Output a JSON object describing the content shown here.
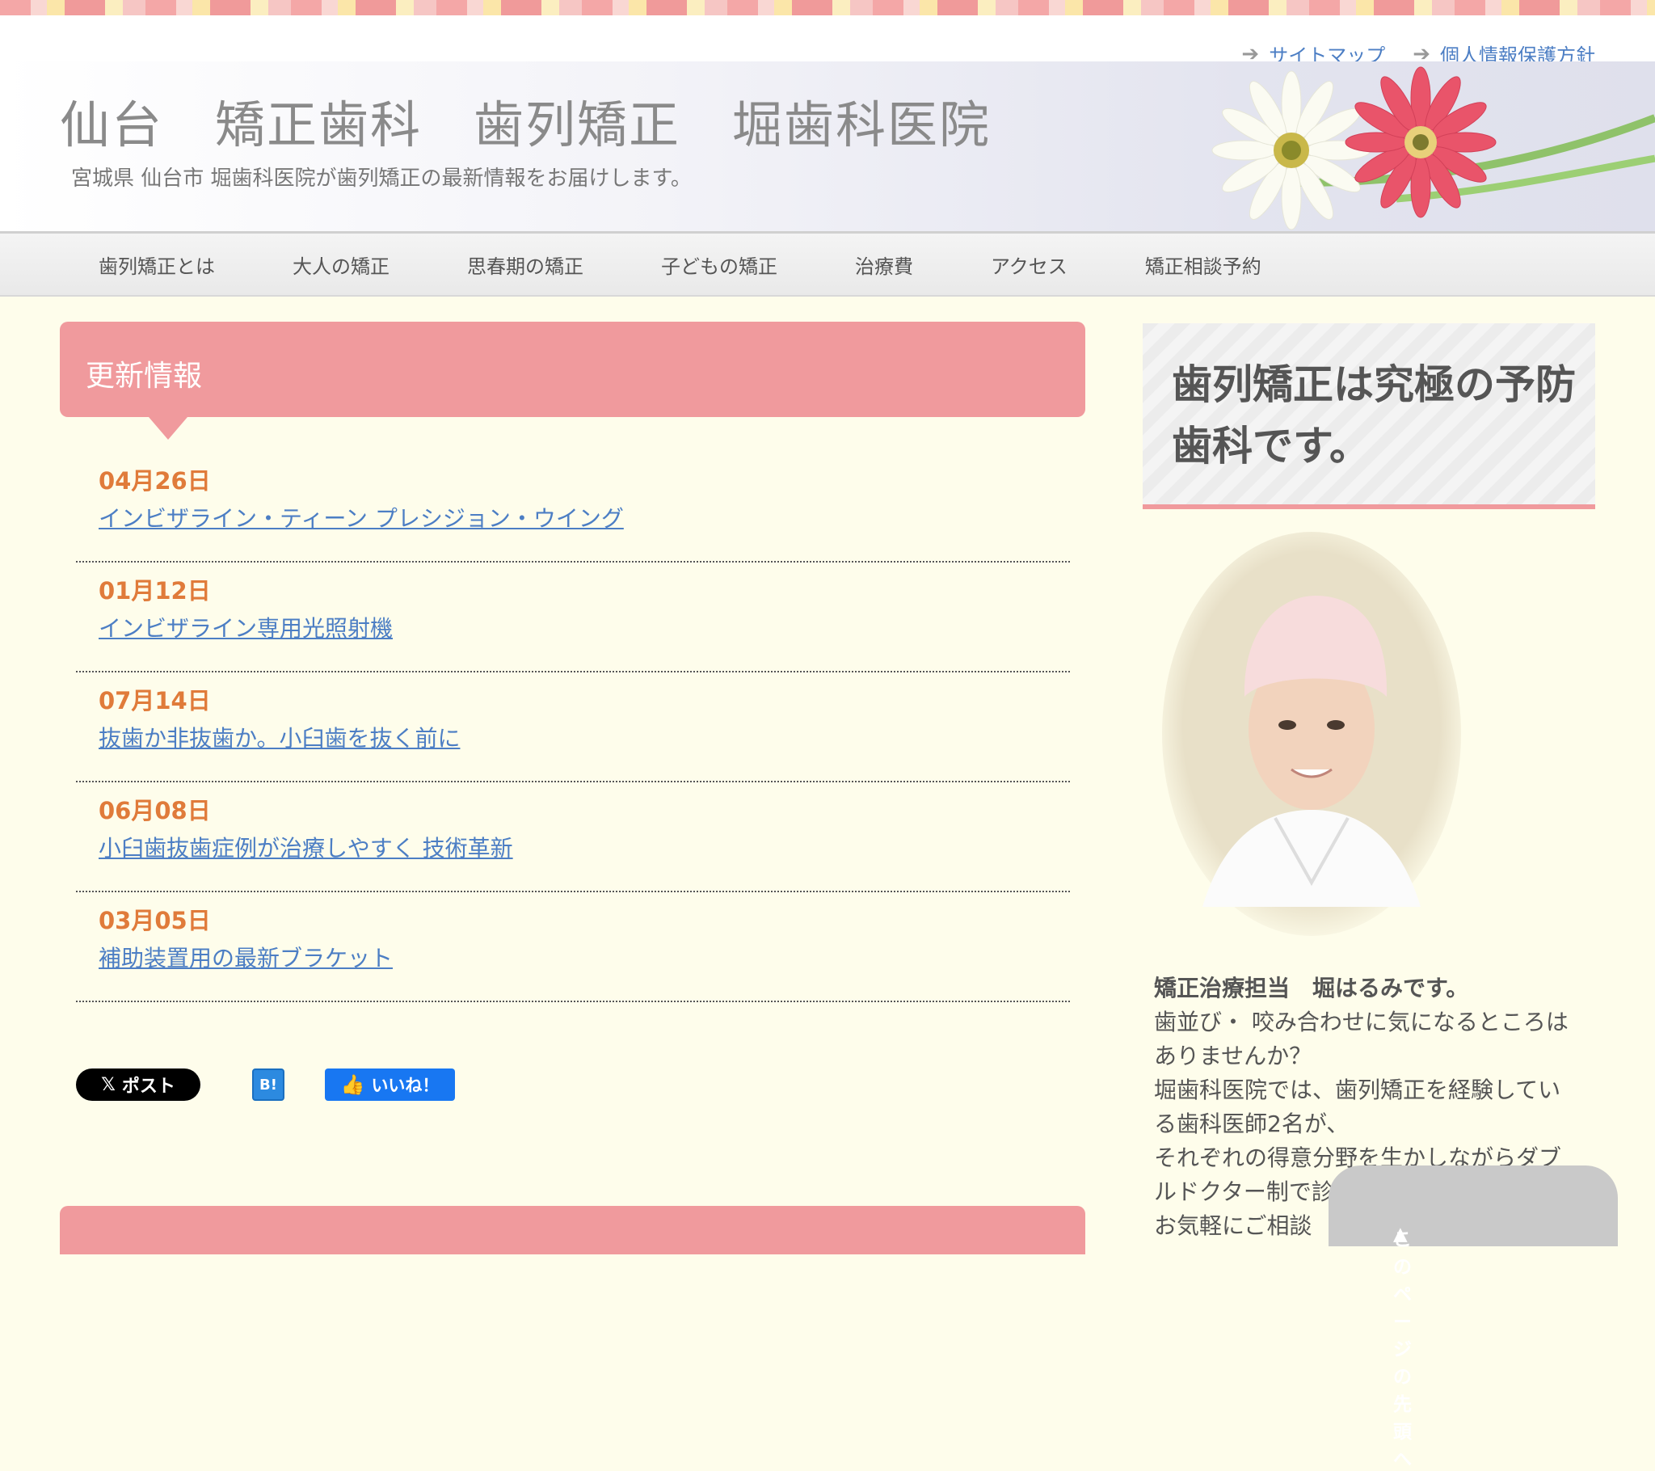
{
  "header": {
    "top_links": [
      {
        "label": "サイトマップ"
      },
      {
        "label": "個人情報保護方針"
      }
    ],
    "site_title": "仙台　矯正歯科　歯列矯正　堀歯科医院",
    "site_subtitle": "宮城県 仙台市 堀歯科医院が歯列矯正の最新情報をお届けします。"
  },
  "nav": {
    "items": [
      {
        "label": "歯列矯正とは"
      },
      {
        "label": "大人の矯正"
      },
      {
        "label": "思春期の矯正"
      },
      {
        "label": "子どもの矯正"
      },
      {
        "label": "治療費"
      },
      {
        "label": "アクセス"
      },
      {
        "label": "矯正相談予約"
      }
    ]
  },
  "news": {
    "heading": "更新情報",
    "items": [
      {
        "date": "04月26日",
        "title": "インビザライン・ティーン プレシジョン・ウイング"
      },
      {
        "date": "01月12日",
        "title": "インビザライン専用光照射機"
      },
      {
        "date": "07月14日",
        "title": "抜歯か非抜歯か。小臼歯を抜く前に"
      },
      {
        "date": "06月08日",
        "title": "小臼歯抜歯症例が治療しやすく 技術革新"
      },
      {
        "date": "03月05日",
        "title": "補助装置用の最新ブラケット"
      }
    ]
  },
  "social": {
    "x_label": "ポスト",
    "hatena_label": "B!",
    "fb_label": "いいね！"
  },
  "sidebar": {
    "banner_text": "歯列矯正は究極の予防歯科です。",
    "lead": "矯正治療担当　堀はるみです。",
    "lines": [
      "歯並び・ 咬み合わせに気になるところは",
      "ありませんか？",
      "堀歯科医院では、歯列矯正を経験してい",
      "る歯科医師2名が、",
      "それぞれの得意分野を生かしながらダブ",
      "ルドクター制で診",
      "お気軽にご相談"
    ]
  },
  "to_top": {
    "label": "このページの先頭へ"
  },
  "colors": {
    "accent": "#f09a9d",
    "link": "#4c7ec4",
    "date": "#e07b3a"
  }
}
